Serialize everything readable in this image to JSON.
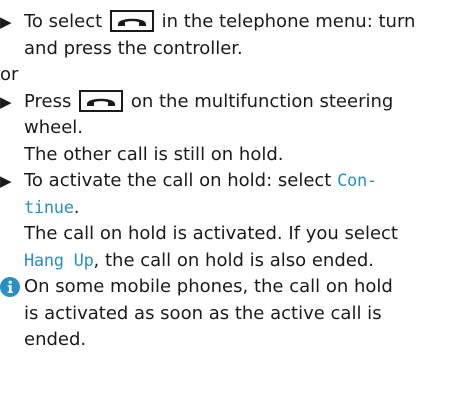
{
  "step1": {
    "bullet": "▶",
    "line1_pre": "To select",
    "key_icon": "phone-handset-icon",
    "line1_post": "in the telephone menu: turn",
    "line2": "and press the controller."
  },
  "or_label": "or",
  "step2": {
    "bullet": "▶",
    "line1_pre": "Press",
    "key_icon": "phone-handset-icon",
    "line1_post": "on the multifunction steering",
    "line2": "wheel.",
    "result": "The other call is still on hold."
  },
  "step3": {
    "bullet": "▶",
    "line1_pre": "To activate the call on hold: select",
    "menu_item_part1": "Con-",
    "menu_item_part2": "tinue",
    "line2_post": ".",
    "result_line1": "The call on hold is activated. If you select",
    "result_menu_item": "Hang Up",
    "result_line2_post": ", the call on hold is also ended."
  },
  "note": {
    "icon": "info-icon",
    "line1": "On some mobile phones, the call on hold",
    "line2": "is activated as soon as the active call is",
    "line3": "ended."
  },
  "colors": {
    "menu_text": "#2a8fc4",
    "info_icon": "#2a8fc4",
    "body_text": "#1a1a1a"
  }
}
